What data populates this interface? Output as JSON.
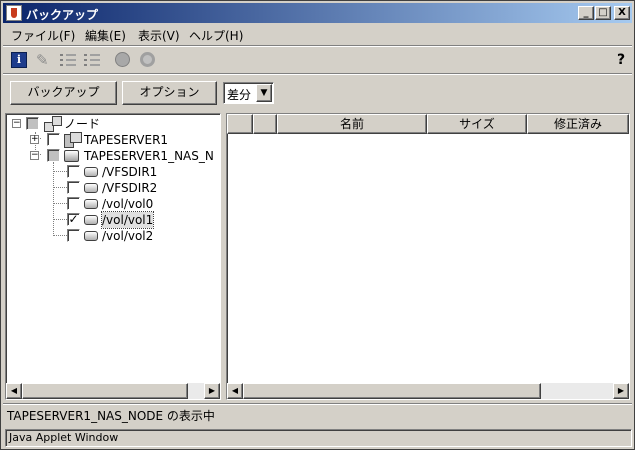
{
  "window": {
    "title": "バックアップ",
    "controls": {
      "minimize": "_",
      "maximize": "□",
      "close": "X"
    }
  },
  "menu": {
    "items": [
      {
        "label": "ファイル(F)"
      },
      {
        "label": "編集(E)"
      },
      {
        "label": "表示(V)"
      },
      {
        "label": "ヘルプ(H)"
      }
    ]
  },
  "toolbar": {
    "icons": [
      "info-icon",
      "brush-icon",
      "list-icon",
      "list-icon",
      "circle-icon",
      "circle-icon",
      "help-icon"
    ],
    "info_glyph": "i",
    "help_glyph": "?"
  },
  "actions": {
    "backup_label": "バックアップ",
    "options_label": "オプション",
    "mode": {
      "selected": "差分",
      "arrow": "▼"
    }
  },
  "tree": {
    "root": {
      "label": "ノード",
      "expanded": true
    },
    "nodes": [
      {
        "label": "TAPESERVER1",
        "expanded": false,
        "checked": false,
        "type": "server"
      },
      {
        "label": "TAPESERVER1_NAS_N",
        "expanded": true,
        "checked": "partial",
        "type": "nas",
        "children": [
          {
            "label": "/VFSDIR1",
            "checked": false
          },
          {
            "label": "/VFSDIR2",
            "checked": false
          },
          {
            "label": "/vol/vol0",
            "checked": false
          },
          {
            "label": "/vol/vol1",
            "checked": true,
            "selected": true
          },
          {
            "label": "/vol/vol2",
            "checked": false
          }
        ]
      }
    ],
    "expand_glyph": "+",
    "collapse_glyph": "−",
    "check_glyph": "✓"
  },
  "file_list": {
    "columns": [
      "",
      "",
      "名前",
      "サイズ",
      "修正済み"
    ],
    "rows": []
  },
  "scroll": {
    "left_arrow": "◀",
    "right_arrow": "▶"
  },
  "status": {
    "text": "TAPESERVER1_NAS_NODE の表示中",
    "applet": "Java Applet Window"
  }
}
